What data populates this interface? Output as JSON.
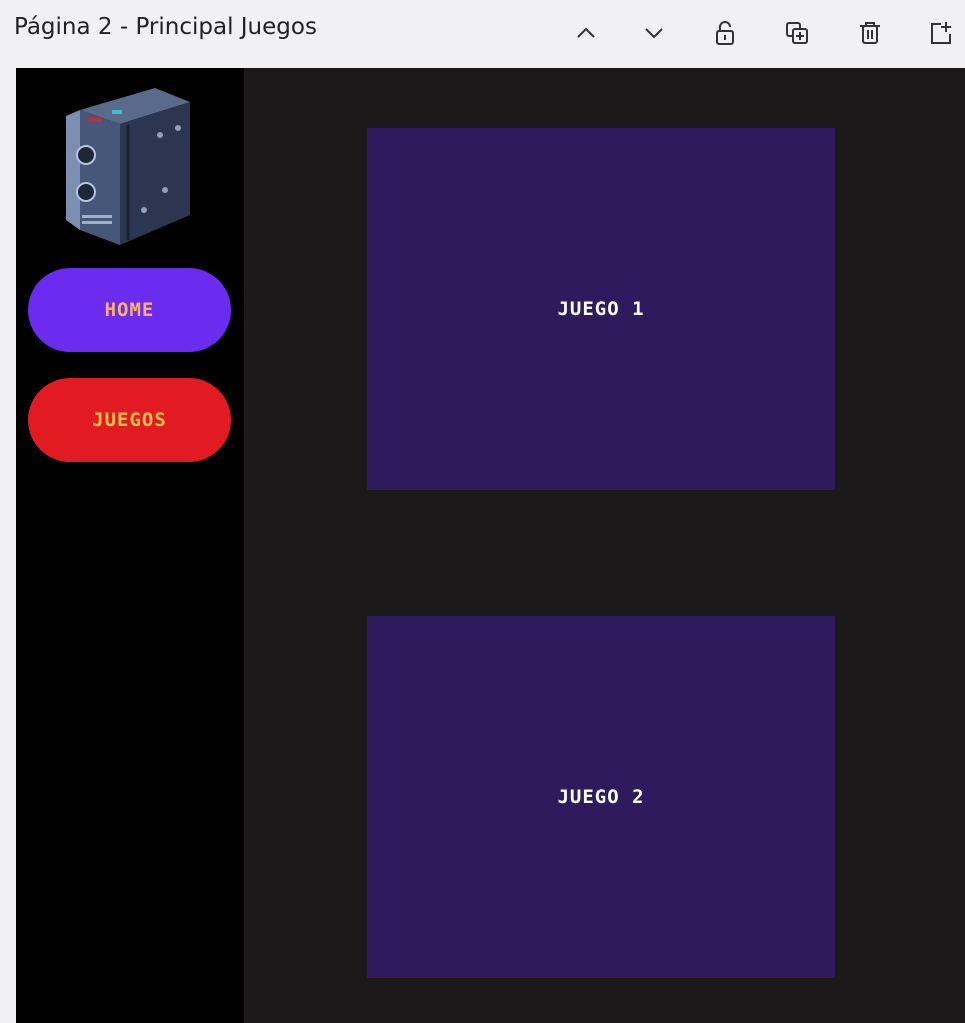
{
  "header": {
    "page_title": "Página 2 - Principal Juegos",
    "tools": [
      {
        "icon": "chevron-up-icon"
      },
      {
        "icon": "chevron-down-icon"
      },
      {
        "icon": "unlock-icon"
      },
      {
        "icon": "duplicate-icon"
      },
      {
        "icon": "trash-icon"
      },
      {
        "icon": "add-page-icon"
      }
    ]
  },
  "sidebar": {
    "logo_icon": "arcade-cabinet-icon",
    "nav": [
      {
        "label": "HOME",
        "color": "#6b2cf0",
        "text_color": "#f4b26a"
      },
      {
        "label": "JUEGOS",
        "color": "#e21b23",
        "text_color": "#f6c24a"
      }
    ]
  },
  "main": {
    "cards": [
      {
        "label": "JUEGO 1"
      },
      {
        "label": "JUEGO 2"
      }
    ]
  },
  "colors": {
    "canvas_bg": "#1b1919",
    "sidebar_bg": "#000000",
    "card_bg": "#2e1a5c",
    "header_bg": "#f1f1f3"
  }
}
